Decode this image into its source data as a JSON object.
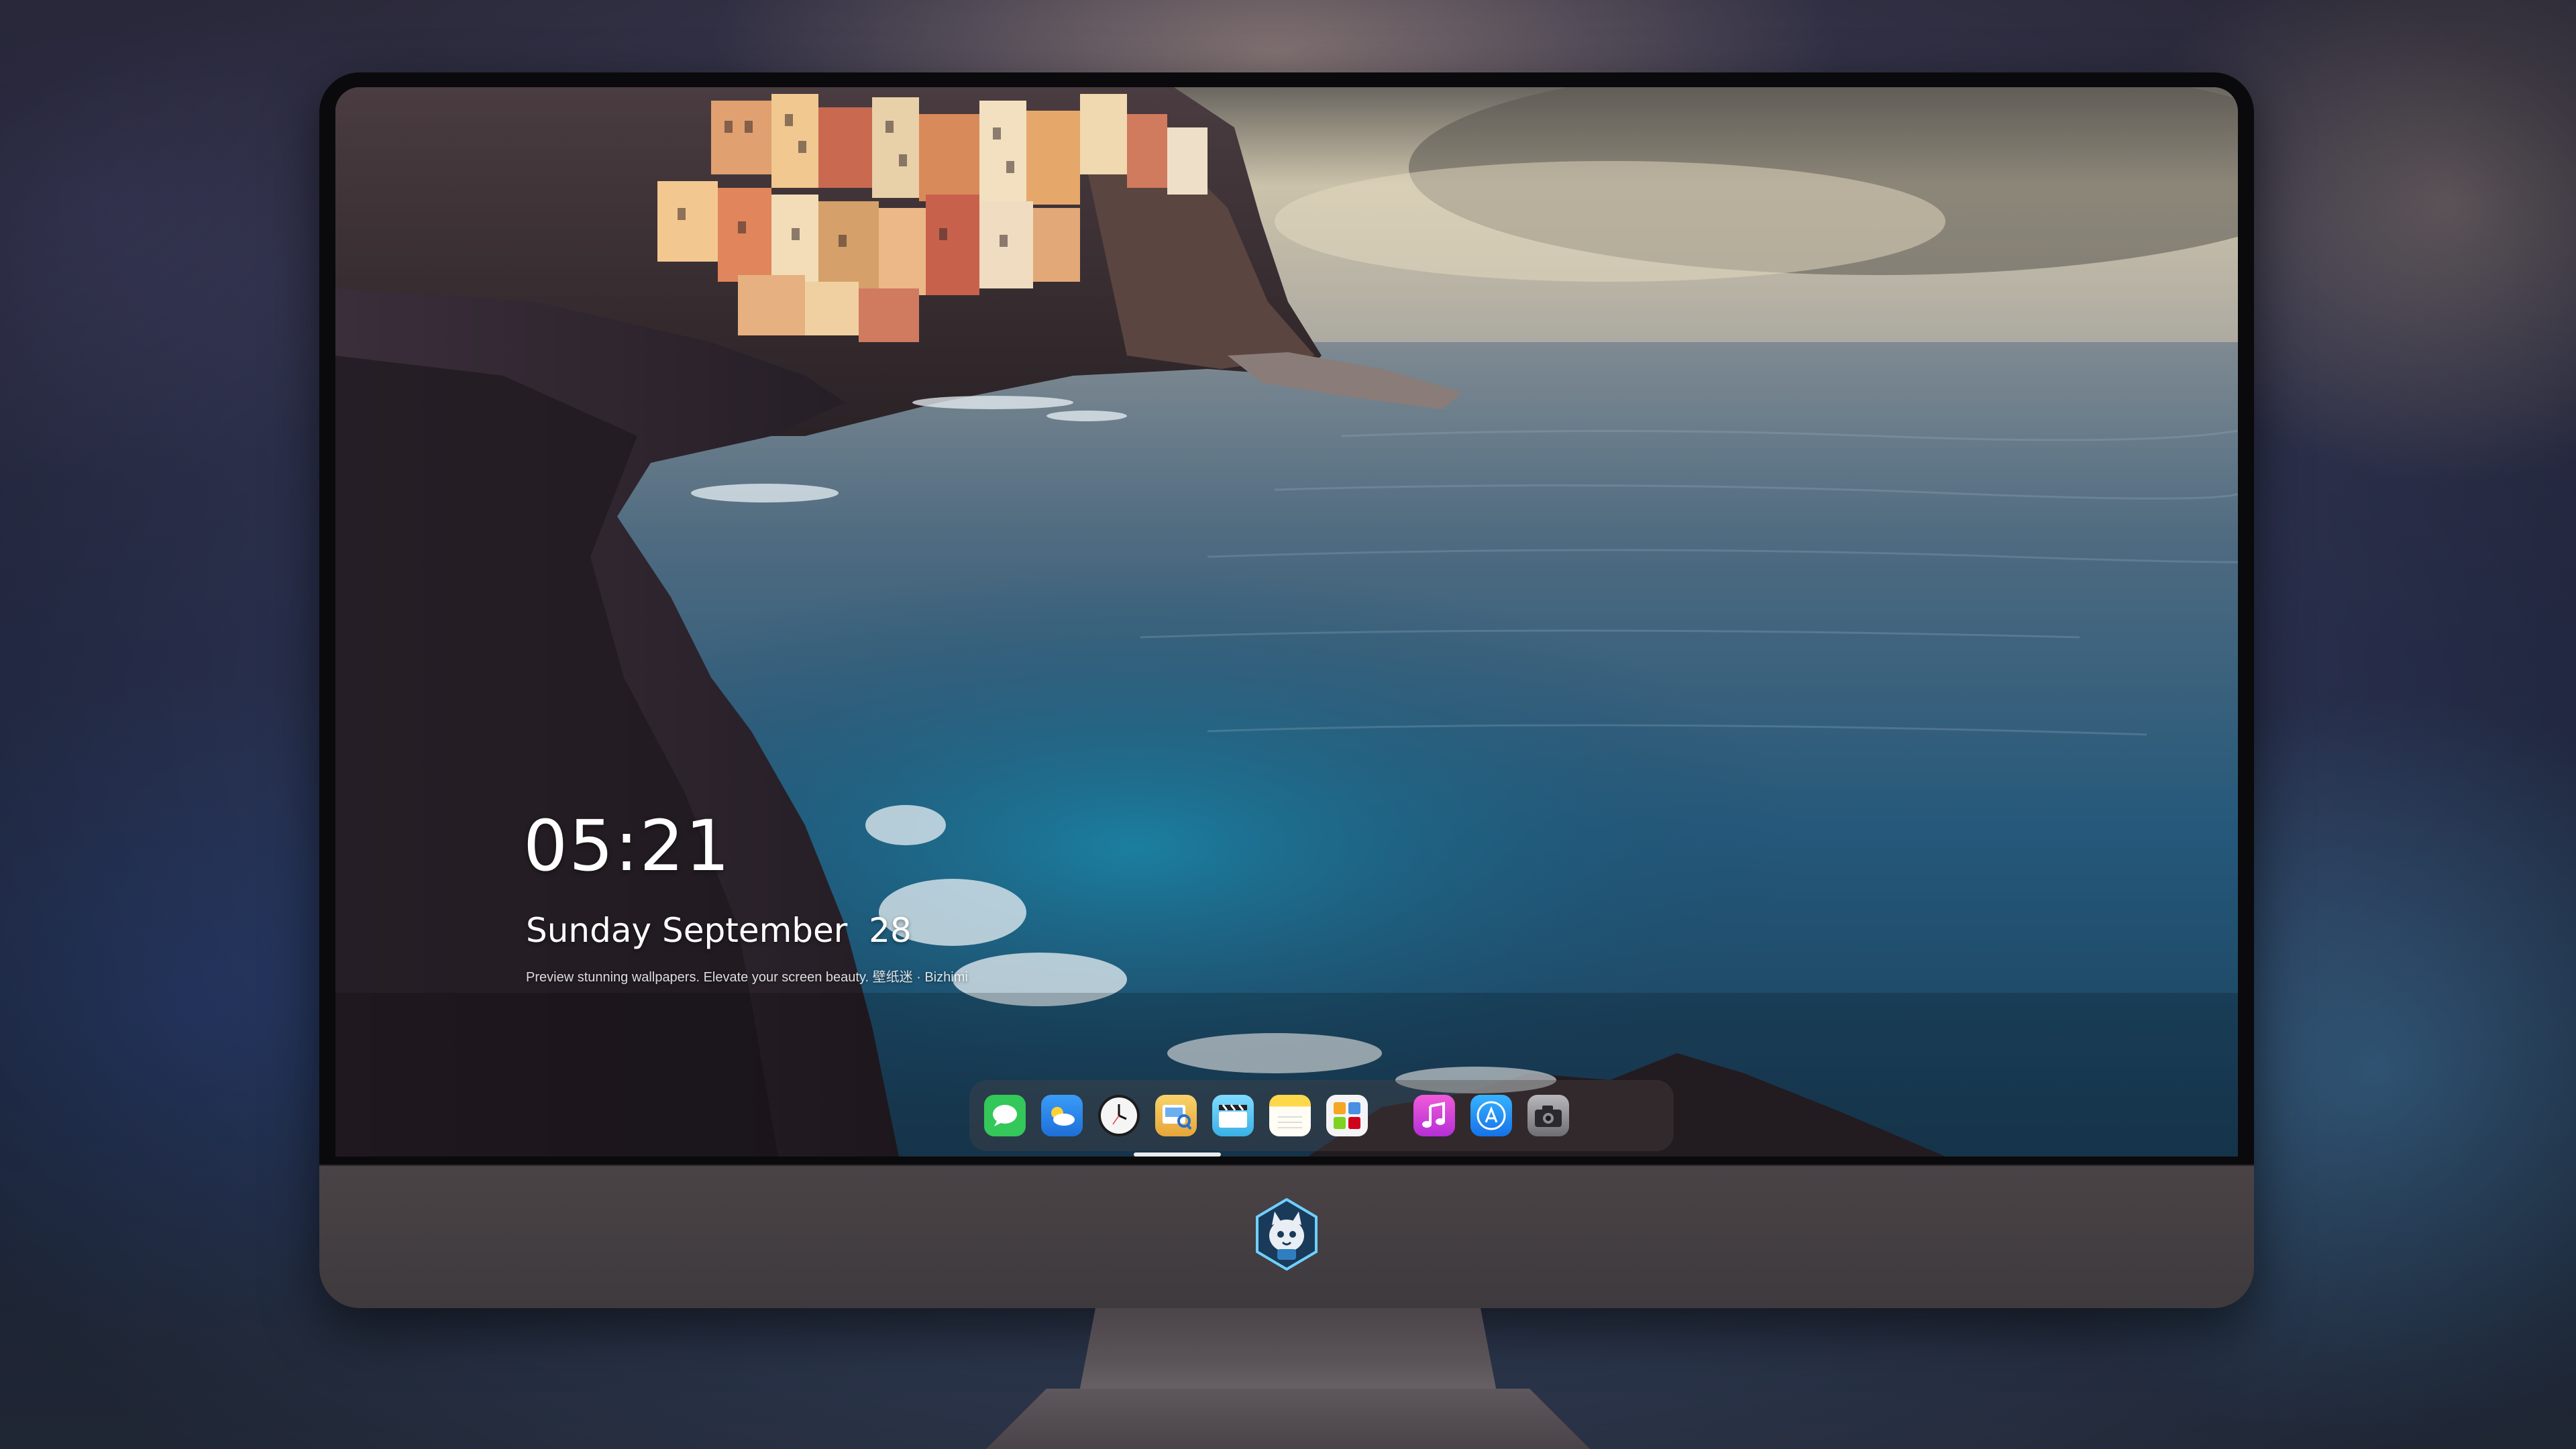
{
  "lock_screen": {
    "time": "05:21",
    "date": "Sunday September  28",
    "tagline": "Preview stunning wallpapers. Elevate your screen beauty. 壁纸迷 · Bizhimi"
  },
  "dock": {
    "apps": [
      {
        "name": "messages-icon",
        "color": "#35c759"
      },
      {
        "name": "weather-icon",
        "color": "#2f8ff5"
      },
      {
        "name": "clock-icon",
        "color": "#f2f2f2"
      },
      {
        "name": "preview-icon",
        "color": "#f5c64a"
      },
      {
        "name": "video-icon",
        "color": "#5ac8fa"
      },
      {
        "name": "notes-icon",
        "color": "#fcd349"
      },
      {
        "name": "photos-app-icon",
        "color": "#f5f5f5"
      },
      {
        "name": "music-icon",
        "color": "#e23bd4"
      },
      {
        "name": "app-store-icon",
        "color": "#1c8cf2"
      },
      {
        "name": "camera-icon",
        "color": "#8e8e93"
      }
    ]
  },
  "colors": {
    "sea": "#1e5f7a",
    "cliff": "#2a2028",
    "sky": "#c9c0aa",
    "bezel": "#0a0a0c",
    "chin": "#433e41"
  }
}
